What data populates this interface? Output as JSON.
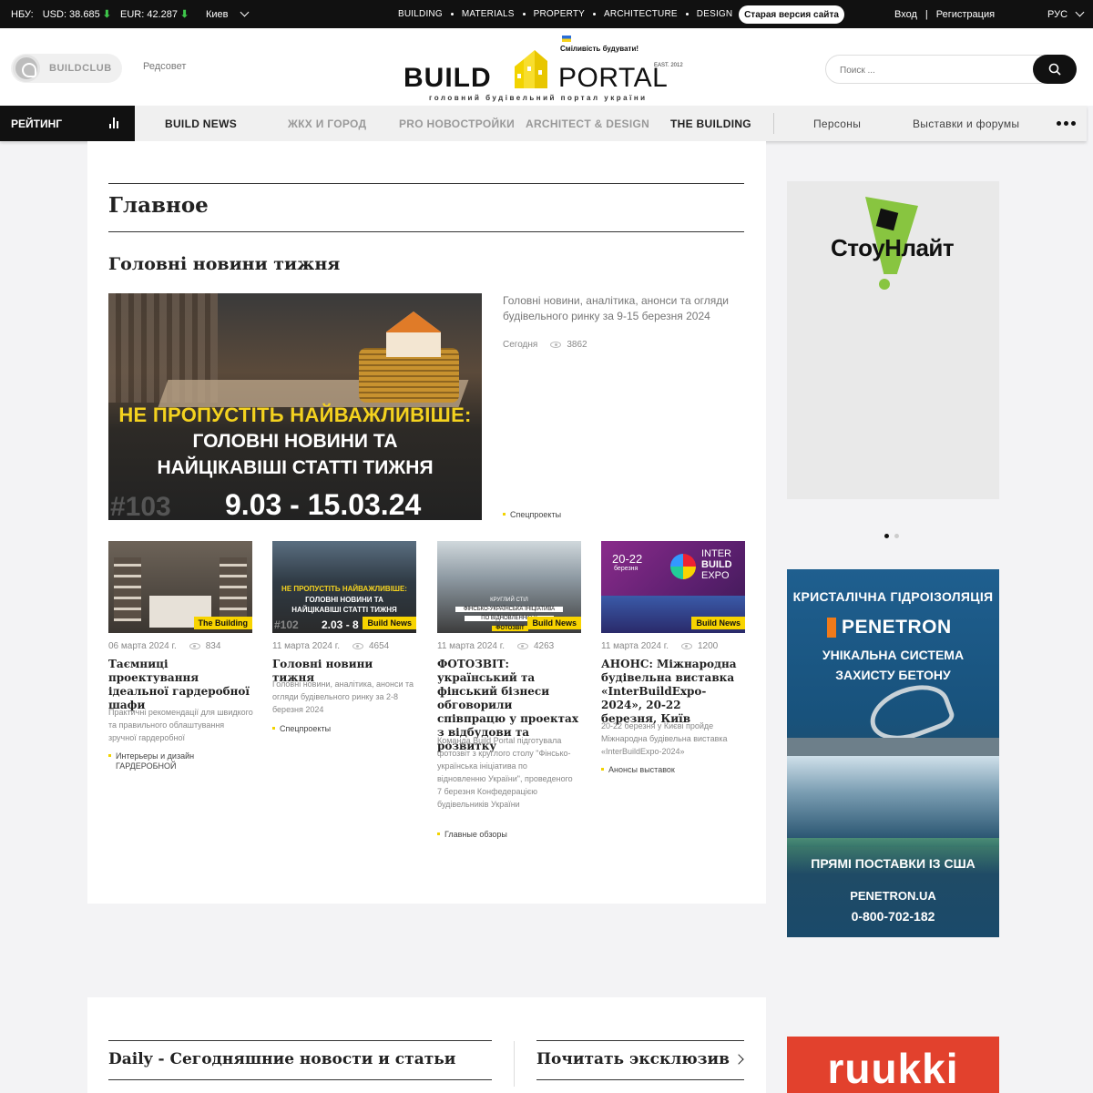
{
  "topbar": {
    "nbu_label": "НБУ:",
    "usd": "USD: 38.685",
    "eur": "EUR: 42.287",
    "arrow": "⬇",
    "city": "Киев",
    "sections": [
      "BUILDING",
      "MATERIALS",
      "PROPERTY",
      "ARCHITECTURE",
      "DESIGN"
    ],
    "old_site": "Старая версия сайта",
    "login": "Вход",
    "divider": "|",
    "register": "Регистрация",
    "lang": "РУС"
  },
  "header": {
    "buildclub": "BUILDCLUB",
    "redsovet": "Редсовет",
    "logo_slogan": "Сміливість будувати!",
    "logo_build": "BUILD",
    "logo_portal": "PORTAL",
    "logo_est": "EAST. 2012",
    "logo_sub": "головний будівельний портал україни",
    "search_placeholder": "Поиск ..."
  },
  "nav": {
    "rating": "РЕЙТИНГ",
    "items": [
      "BUILD NEWS",
      "ЖКХ И ГОРОД",
      "PRO НОВОСТРОЙКИ",
      "ARCHITECT & DESIGN",
      "THE BUILDING",
      "Персоны",
      "Выставки и форумы"
    ]
  },
  "main": {
    "heading": "Главное",
    "week_heading": "Головні новини тижня",
    "hero": {
      "img_line1": "НЕ ПРОПУСТІТЬ НАЙВАЖЛИВІШЕ:",
      "img_line2": "ГОЛОВНІ НОВИНИ ТА",
      "img_line3": "НАЙЦІКАВІШІ СТАТТІ ТИЖНЯ",
      "img_num": "#103",
      "img_dates": "9.03 - 15.03.24",
      "text": "Головні новини, аналітика, анонси та огляди будівельного ринку за 9-15 березня 2024",
      "date": "Сегодня",
      "views": "3862",
      "tag": "Спецпроекты"
    },
    "cards": [
      {
        "badge": "The Building",
        "date": "06 марта 2024 г.",
        "views": "834",
        "title": "Таємниці проектування ідеальної гардеробної шафи",
        "desc": "Практичні рекомендації для швидкого та правильного облаштування зручної гардеробної",
        "tag": "Интерьеры и дизайн ГАРДЕРОБНОЙ"
      },
      {
        "badge": "Build News",
        "img_line1": "НЕ ПРОПУСТІТЬ НАЙВАЖЛИВІШЕ:",
        "img_line2": "ГОЛОВНІ НОВИНИ ТА",
        "img_line3": "НАЙЦІКАВІШІ СТАТТІ ТИЖНЯ",
        "img_num": "#102",
        "img_dates": "2.03 - 8",
        "date": "11 марта 2024 г.",
        "views": "4654",
        "title": "Головні новини тижня",
        "desc": "Головні новини, аналітика, анонси та огляди будівельного ринку за 2-8 березня 2024",
        "tag": "Спецпроекты"
      },
      {
        "badge": "Build News",
        "img_line1": "КРУГЛИЙ СТІЛ",
        "img_line2": "ФІНСЬКО-УКРАЇНСЬКА ІНІЦІАТИВА",
        "img_line3": "ПО ВІДНОВЛЕННЮ У",
        "img_line4": "ФОТОЗВІТ",
        "date": "11 марта 2024 г.",
        "views": "4263",
        "title": "ФОТОЗВІТ: український та фінський бізнеси обговорили співпрацю у проектах з відбудови та розвитку",
        "desc": "Команда Build Portal підготувала фотозвіт з круглого столу \"Фінсько-українська ініціатива по відновленню України\", проведеного 7 березня Конфедерацією будівельників України",
        "tag": "Главные обзоры"
      },
      {
        "badge": "Build News",
        "img_dates": "20-22",
        "img_month": "березня",
        "img_brand1": "INTER",
        "img_brand2": "BUILD",
        "img_brand3": "EXPO",
        "date": "11 марта 2024 г.",
        "views": "1200",
        "title": "АНОНС: Міжнародна будівельна виставка «InterBuildExpo-2024», 20-22 березня, Київ",
        "desc": "20-22 березня у Києві пройде Міжнародна будівельна виставка «InterBuildExpo-2024»",
        "tag": "Анонсы выставок"
      }
    ]
  },
  "sidebar": {
    "ad1_word": "СтоуНлайт",
    "ad2": {
      "line1": "КРИСТАЛІЧНА ГІДРОІЗОЛЯЦІЯ",
      "brand": "PENETRON",
      "line3": "УНІКАЛЬНА СИСТЕМА",
      "line4": "ЗАХИСТУ БЕТОНУ",
      "line5": "ПРЯМІ ПОСТАВКИ ІЗ США",
      "line6": "PENETRON.UA",
      "line7": "0-800-702-182"
    },
    "ad3_word": "ruukki"
  },
  "bottom": {
    "daily": "Daily - Сегодняшние новости и статьи",
    "exclusive": "Почитать эксклюзив"
  },
  "colors": {
    "accent_yellow": "#f8d400",
    "dark": "#111111",
    "green_arrow": "#3ec64a",
    "ruukki_red": "#e2412d"
  }
}
